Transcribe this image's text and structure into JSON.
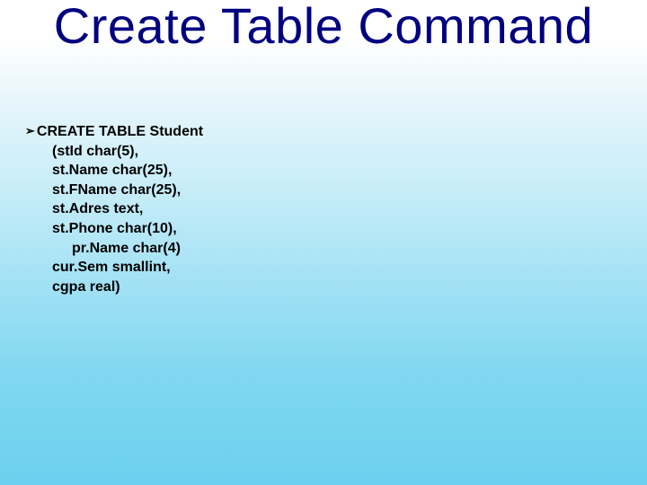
{
  "title": "Create Table Command",
  "bullet": "CREATE TABLE Student",
  "lines": {
    "l1": "(stId char(5),",
    "l2": "st.Name  char(25),",
    "l3": "st.FName char(25),",
    "l4": "st.Adres text,",
    "l5": "st.Phone char(10),",
    "l6": "pr.Name char(4)",
    "l7": "cur.Sem  smallint,",
    "l8": "cgpa real)"
  }
}
